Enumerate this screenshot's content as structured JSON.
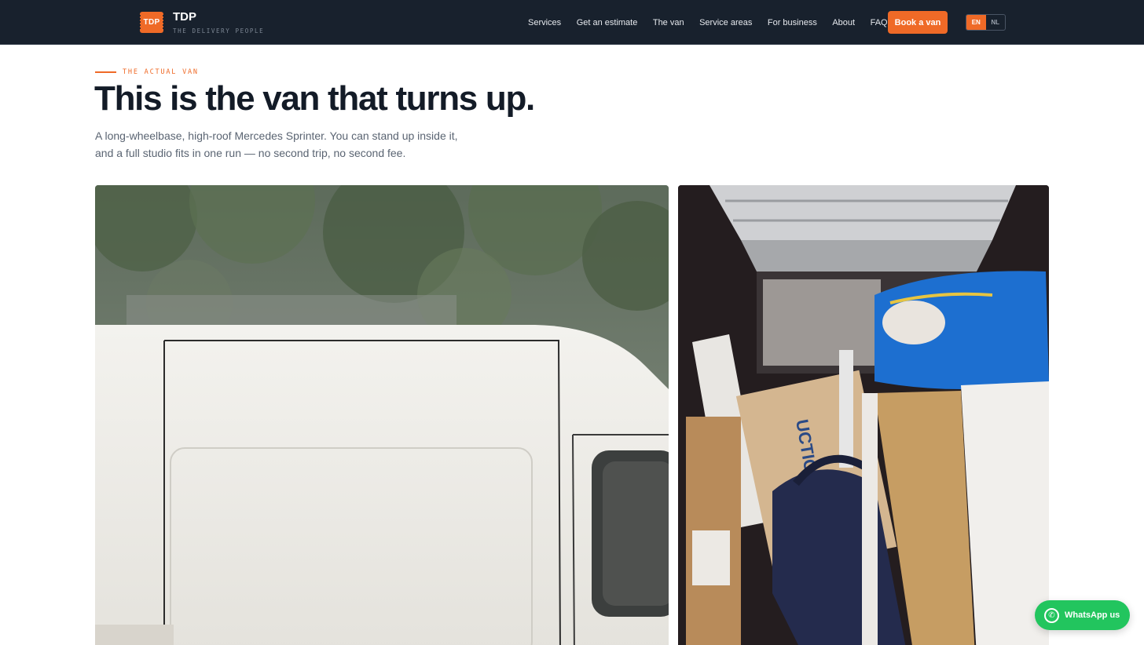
{
  "header": {
    "logo_text": "TDP",
    "brand_name": "TDP",
    "brand_tagline": "THE DELIVERY PEOPLE",
    "nav": [
      {
        "label": "Services"
      },
      {
        "label": "Get an estimate"
      },
      {
        "label": "The van"
      },
      {
        "label": "Service areas"
      },
      {
        "label": "For business"
      },
      {
        "label": "About"
      },
      {
        "label": "FAQ"
      }
    ],
    "cta_label": "Book a van",
    "languages": [
      {
        "label": "EN",
        "active": true
      },
      {
        "label": "NL",
        "active": false
      }
    ]
  },
  "hero": {
    "eyebrow": "THE ACTUAL VAN",
    "title": "This is the van that turns up.",
    "description_line1": "A long-wheelbase, high-roof Mercedes Sprinter. You can stand up inside it,",
    "description_line2": "and a full studio fits in one run — no second trip, no second fee."
  },
  "photos": [
    {
      "subject": "white-van-side"
    },
    {
      "subject": "loaded-van-cargo"
    }
  ],
  "whatsapp": {
    "label": "WhatsApp us",
    "icon": "whatsapp-icon"
  },
  "colors": {
    "accent": "#ef6a27",
    "header_bg": "#18212d",
    "whatsapp": "#22c55e"
  }
}
